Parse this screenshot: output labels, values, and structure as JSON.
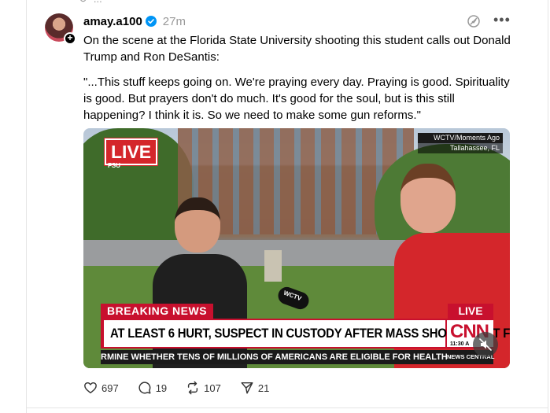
{
  "feed": {
    "top_peek_text": "..."
  },
  "post": {
    "username": "amay.a100",
    "timestamp": "27m",
    "text_line1": "On the scene at the Florida State University shooting this student calls out Donald Trump and Ron DeSantis:",
    "quote": "\"...This stuff keeps going on. We're praying every day. Praying is good. Spirituality is good. But prayers don't do much. It's good for the soul, but is this still happening? I think it is. So we need to make some gun reforms.\"",
    "icons": {
      "verified": "verified-badge-icon",
      "translate": "translate-icon",
      "more": "more-options-icon",
      "follow": "plus-icon"
    },
    "colors": {
      "verified": "#0095f6",
      "text": "#000000",
      "muted": "#999999"
    }
  },
  "video": {
    "live_badge": "LIVE",
    "live_badge_sub": "FSU",
    "location_line1": "WCTV/Moments Ago",
    "location_line2": "Tallahassee, FL",
    "breaking_label": "BREAKING NEWS",
    "live_label": "LIVE",
    "headline": "AT LEAST 6 HURT, SUSPECT IN CUSTODY AFTER MASS SHOOTING AT FSU",
    "network_logo": "CNN",
    "clock": "11:30 A",
    "ticker": "RMINE WHETHER TENS OF MILLIONS OF AMERICANS ARE ELIGIBLE FOR HEALTH PROG",
    "ticker_brand": "NEWS CENTRAL",
    "mic_label": "WCTV",
    "mute_icon": "muted-speaker-icon",
    "colors": {
      "cnn_red": "#c8102e"
    }
  },
  "actions": {
    "likes": "697",
    "replies": "19",
    "reposts": "107",
    "shares": "21",
    "icons": [
      "heart-icon",
      "comment-icon",
      "repost-icon",
      "share-icon"
    ]
  }
}
